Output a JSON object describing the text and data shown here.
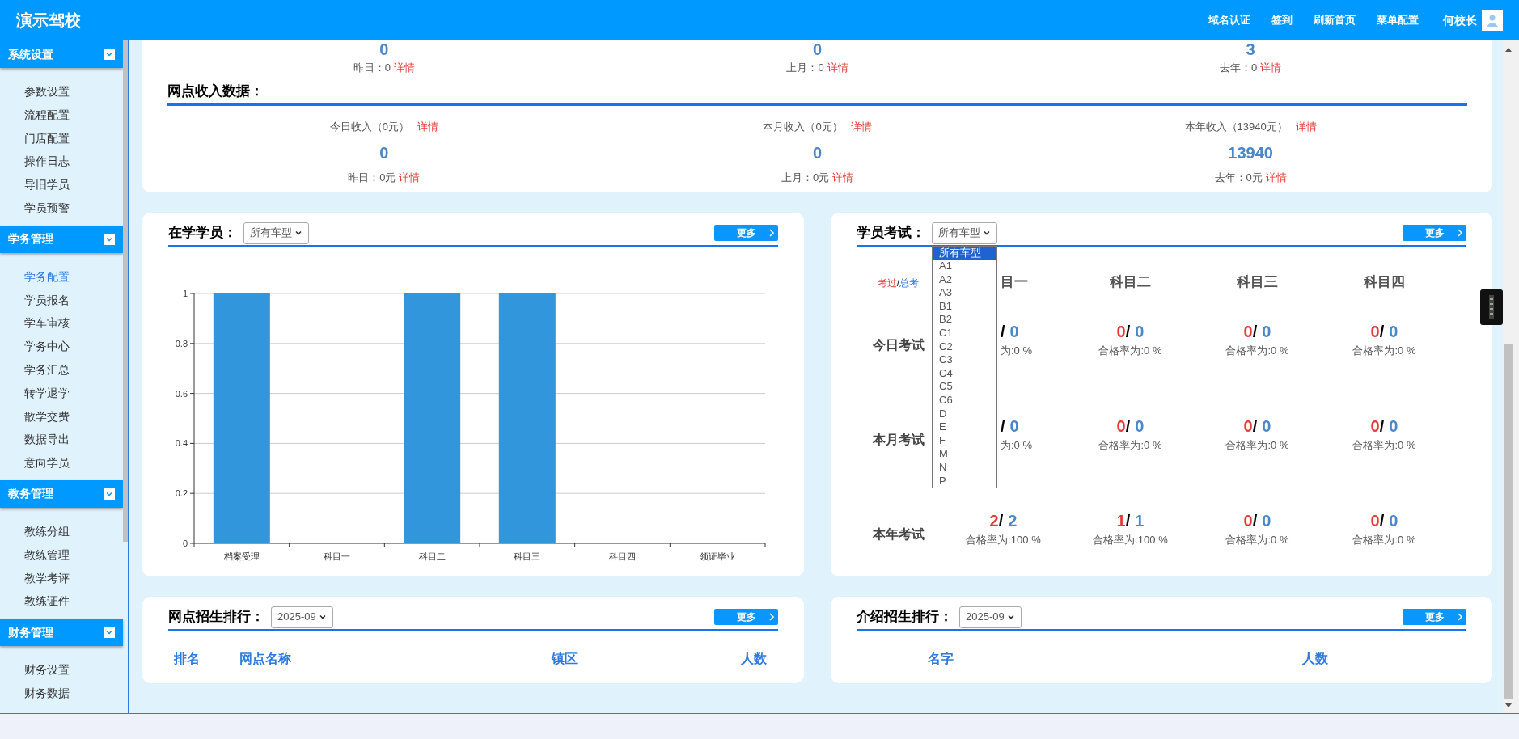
{
  "app_title": "演示驾校",
  "top_links": [
    "域名认证",
    "签到",
    "刷新首页",
    "菜单配置"
  ],
  "user": {
    "name": "何校长"
  },
  "sidebar": {
    "groups": [
      {
        "title": "系统设置",
        "expanded": true,
        "items": [
          {
            "label": "参数设置",
            "selected": false
          },
          {
            "label": "流程配置",
            "selected": false
          },
          {
            "label": "门店配置",
            "selected": false
          },
          {
            "label": "操作日志",
            "selected": false
          },
          {
            "label": "导旧学员",
            "selected": false
          },
          {
            "label": "学员预警",
            "selected": false
          }
        ]
      },
      {
        "title": "学务管理",
        "expanded": true,
        "items": [
          {
            "label": "学务配置",
            "selected": true
          },
          {
            "label": "学员报名",
            "selected": false
          },
          {
            "label": "学车审核",
            "selected": false
          },
          {
            "label": "学务中心",
            "selected": false
          },
          {
            "label": "学务汇总",
            "selected": false
          },
          {
            "label": "转学退学",
            "selected": false
          },
          {
            "label": "散学交费",
            "selected": false
          },
          {
            "label": "数据导出",
            "selected": false
          },
          {
            "label": "意向学员",
            "selected": false
          }
        ]
      },
      {
        "title": "教务管理",
        "expanded": true,
        "items": [
          {
            "label": "教练分组",
            "selected": false
          },
          {
            "label": "教练管理",
            "selected": false
          },
          {
            "label": "教学考评",
            "selected": false
          },
          {
            "label": "教练证件",
            "selected": false
          }
        ]
      },
      {
        "title": "财务管理",
        "expanded": true,
        "items": [
          {
            "label": "财务设置",
            "selected": false
          },
          {
            "label": "财务数据",
            "selected": false
          }
        ]
      }
    ]
  },
  "summary": {
    "top_row": [
      {
        "value": "0",
        "prev": "昨日：0",
        "link": "详情"
      },
      {
        "value": "0",
        "prev": "上月：0",
        "link": "详情"
      },
      {
        "value": "3",
        "prev": "去年：0",
        "link": "详情"
      }
    ],
    "income": {
      "title": "网点收入数据：",
      "items": [
        {
          "label": "今日收入（0元）",
          "link": "详情",
          "value": "0",
          "prev": "昨日：0元",
          "prev_link": "详情"
        },
        {
          "label": "本月收入（0元）",
          "link": "详情",
          "value": "0",
          "prev": "上月：0元",
          "prev_link": "详情"
        },
        {
          "label": "本年收入（13940元）",
          "link": "详情",
          "value": "13940",
          "prev": "去年：0元",
          "prev_link": "详情"
        }
      ]
    }
  },
  "students": {
    "title": "在学学员：",
    "filter": "所有车型",
    "more": "更多",
    "chart_data": {
      "type": "bar",
      "categories": [
        "档案受理",
        "科目一",
        "科目二",
        "科目三",
        "科目四",
        "领证毕业"
      ],
      "values": [
        1,
        0,
        1,
        1,
        0,
        0
      ],
      "ylim": [
        0,
        1
      ],
      "yticks": [
        0,
        0.2,
        0.4,
        0.6,
        0.8,
        1
      ],
      "grid": true
    }
  },
  "exams": {
    "title": "学员考试：",
    "more": "更多",
    "filter": {
      "value": "所有车型",
      "open": true,
      "options": [
        {
          "label": "所有车型",
          "selected": true
        },
        {
          "label": "A1",
          "selected": false
        },
        {
          "label": "A2",
          "selected": false
        },
        {
          "label": "A3",
          "selected": false
        },
        {
          "label": "B1",
          "selected": false
        },
        {
          "label": "B2",
          "selected": false
        },
        {
          "label": "C1",
          "selected": false
        },
        {
          "label": "C2",
          "selected": false
        },
        {
          "label": "C3",
          "selected": false
        },
        {
          "label": "C4",
          "selected": false
        },
        {
          "label": "C5",
          "selected": false
        },
        {
          "label": "C6",
          "selected": false
        },
        {
          "label": "D",
          "selected": false
        },
        {
          "label": "E",
          "selected": false
        },
        {
          "label": "F",
          "selected": false
        },
        {
          "label": "M",
          "selected": false
        },
        {
          "label": "N",
          "selected": false
        },
        {
          "label": "P",
          "selected": false
        }
      ]
    },
    "legend": {
      "passed": "考过",
      "sep": "/",
      "total": "总考"
    },
    "columns": [
      {
        "label": "目一",
        "clipped": true
      },
      {
        "label": "科目二",
        "clipped": false
      },
      {
        "label": "科目三",
        "clipped": false
      },
      {
        "label": "科目四",
        "clipped": false
      }
    ],
    "rows": [
      {
        "label": "今日考试",
        "cells": [
          {
            "clipped": true,
            "sep": "/",
            "total": "0",
            "rate": "为:0 %"
          },
          {
            "clipped": false,
            "passed": "0",
            "sep": "/",
            "total": "0",
            "rate": "合格率为:0 %"
          },
          {
            "clipped": false,
            "passed": "0",
            "sep": "/",
            "total": "0",
            "rate": "合格率为:0 %"
          },
          {
            "clipped": false,
            "passed": "0",
            "sep": "/",
            "total": "0",
            "rate": "合格率为:0 %"
          }
        ]
      },
      {
        "label": "本月考试",
        "cells": [
          {
            "clipped": true,
            "sep": "/",
            "total": "0",
            "rate": "为:0 %"
          },
          {
            "clipped": false,
            "passed": "0",
            "sep": "/",
            "total": "0",
            "rate": "合格率为:0 %"
          },
          {
            "clipped": false,
            "passed": "0",
            "sep": "/",
            "total": "0",
            "rate": "合格率为:0 %"
          },
          {
            "clipped": false,
            "passed": "0",
            "sep": "/",
            "total": "0",
            "rate": "合格率为:0 %"
          }
        ]
      },
      {
        "label": "本年考试",
        "cells": [
          {
            "clipped": false,
            "passed": "2",
            "sep": "/",
            "total": "2",
            "rate": "合格率为:100 %"
          },
          {
            "clipped": false,
            "passed": "1",
            "sep": "/",
            "total": "1",
            "rate": "合格率为:100 %"
          },
          {
            "clipped": false,
            "passed": "0",
            "sep": "/",
            "total": "0",
            "rate": "合格率为:0 %"
          },
          {
            "clipped": false,
            "passed": "0",
            "sep": "/",
            "total": "0",
            "rate": "合格率为:0 %"
          }
        ]
      }
    ]
  },
  "branch_ranking": {
    "title": "网点招生排行：",
    "filter": "2025-09",
    "more": "更多",
    "columns": [
      "排名",
      "网点名称",
      "镇区",
      "人数"
    ]
  },
  "referral_ranking": {
    "title": "介绍招生排行：",
    "filter": "2025-09",
    "more": "更多",
    "columns": [
      "名字",
      "人数"
    ]
  }
}
